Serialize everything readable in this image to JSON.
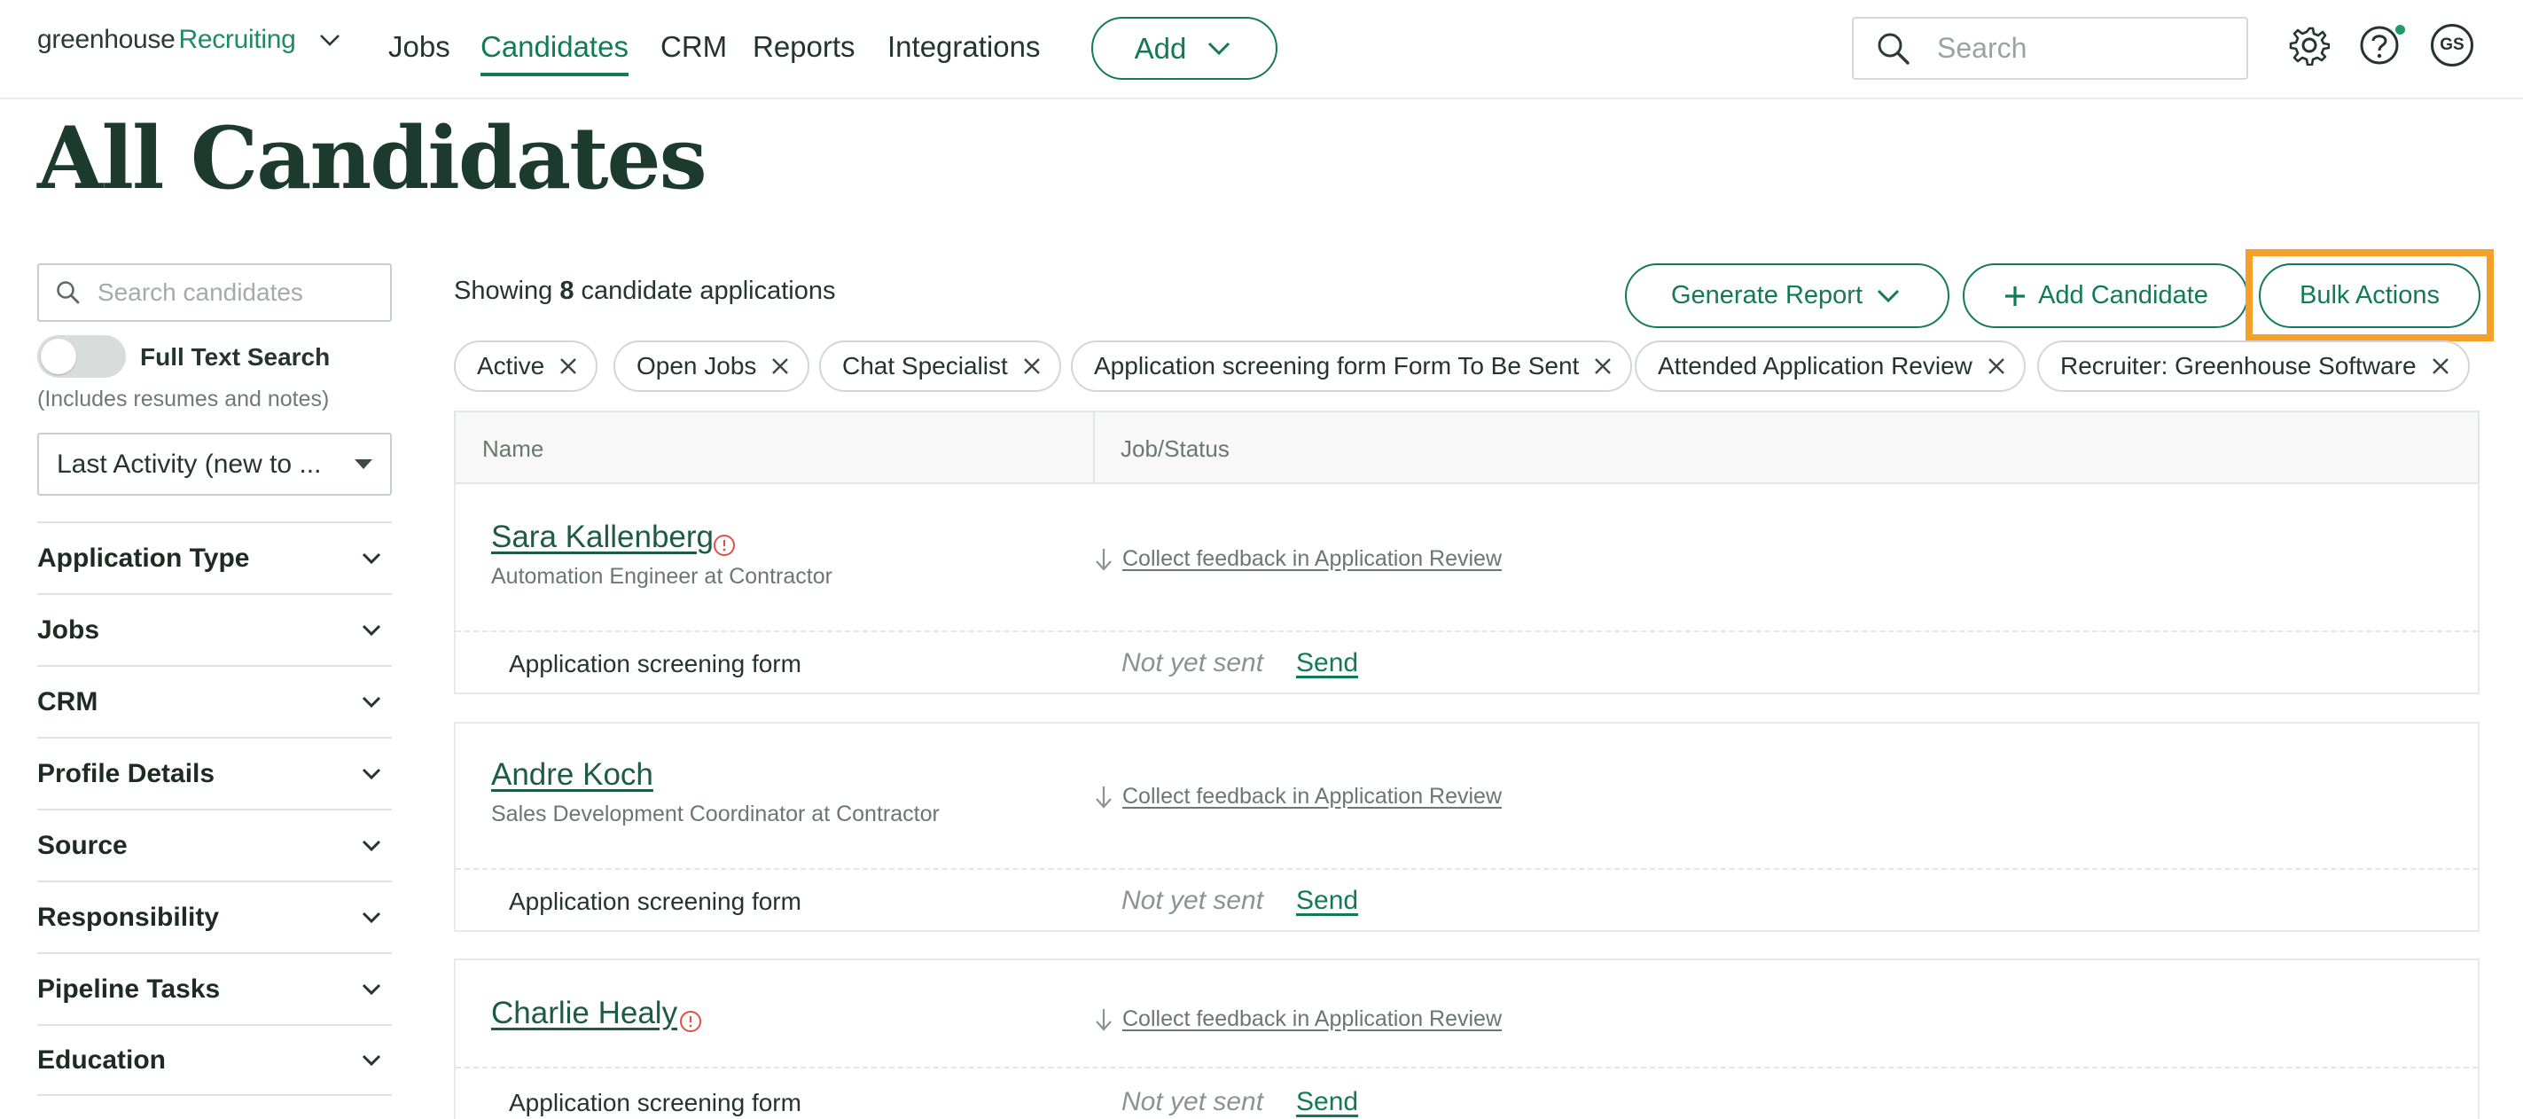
{
  "nav": {
    "brand_main": "greenhouse",
    "brand_accent": "Recruiting",
    "items": [
      "Jobs",
      "Candidates",
      "CRM",
      "Reports",
      "Integrations"
    ],
    "active": "Candidates",
    "add_label": "Add",
    "search_placeholder": "Search",
    "avatar_initials": "GS"
  },
  "page": {
    "title": "All Candidates"
  },
  "sidebar": {
    "search_placeholder": "Search candidates",
    "full_text_label": "Full Text Search",
    "full_text_note": "(Includes resumes and notes)",
    "sort_value": "Last Activity (new to ...",
    "filters": [
      "Application Type",
      "Jobs",
      "CRM",
      "Profile Details",
      "Source",
      "Responsibility",
      "Pipeline Tasks",
      "Education"
    ]
  },
  "main": {
    "showing_prefix": "Showing ",
    "showing_count": "8",
    "showing_suffix": " candidate applications",
    "generate_report": "Generate Report",
    "add_candidate": "Add Candidate",
    "bulk_actions": "Bulk Actions",
    "chips": [
      "Active",
      "Open Jobs",
      "Chat Specialist",
      "Application screening form Form To Be Sent",
      "Attended Application Review",
      "Recruiter: Greenhouse Software"
    ],
    "columns": [
      "Name",
      "Job/Status"
    ]
  },
  "candidates": [
    {
      "name": "Sara Kallenberg",
      "warning": true,
      "title": "Automation Engineer at Contractor",
      "status": "Collect feedback in Application Review",
      "form": "Application screening form",
      "form_status": "Not yet sent",
      "action": "Send"
    },
    {
      "name": "Andre Koch",
      "warning": false,
      "title": "Sales Development Coordinator at Contractor",
      "status": "Collect feedback in Application Review",
      "form": "Application screening form",
      "form_status": "Not yet sent",
      "action": "Send"
    },
    {
      "name": "Charlie Healy",
      "warning": true,
      "title": "",
      "status": "Collect feedback in Application Review",
      "form": "Application screening form",
      "form_status": "Not yet sent",
      "action": "Send"
    }
  ],
  "colors": {
    "brand": "#127a58",
    "highlight": "#f6a02b",
    "title": "#1c3a2e"
  }
}
